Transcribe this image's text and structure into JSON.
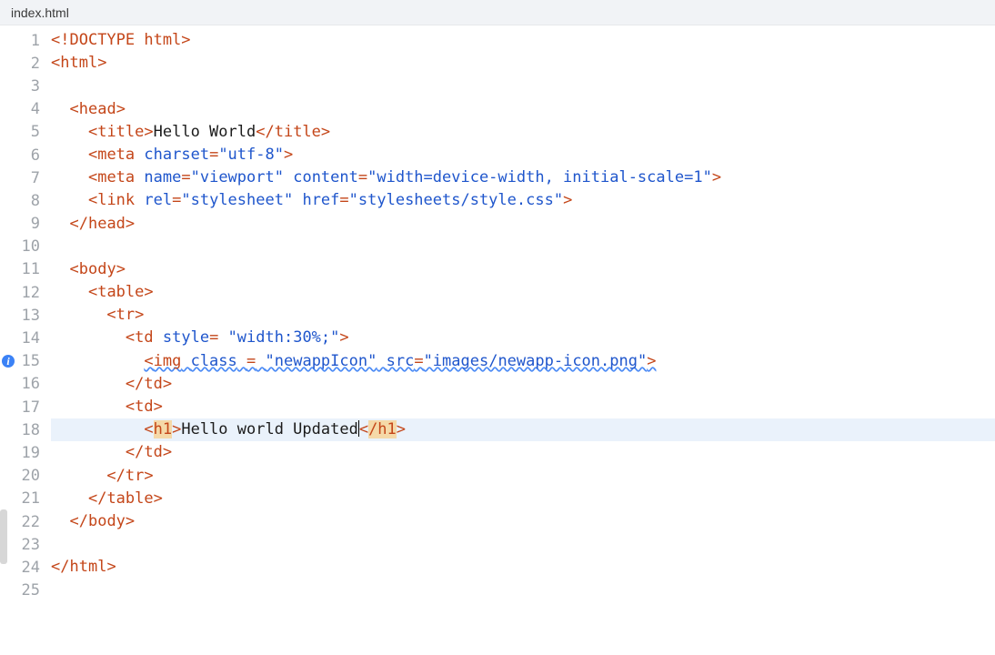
{
  "file": {
    "name": "index.html"
  },
  "editor": {
    "highlightedLine": 18,
    "infoMarkerLine": 15
  },
  "lines": {
    "1": [
      {
        "cls": "tk-doctype",
        "t": "<!DOCTYPE html>"
      }
    ],
    "2": [
      {
        "cls": "tk-punct",
        "t": "<"
      },
      {
        "cls": "tk-tag",
        "t": "html"
      },
      {
        "cls": "tk-punct",
        "t": ">"
      }
    ],
    "3": [],
    "4": [
      {
        "cls": "",
        "t": "  "
      },
      {
        "cls": "tk-punct",
        "t": "<"
      },
      {
        "cls": "tk-tag",
        "t": "head"
      },
      {
        "cls": "tk-punct",
        "t": ">"
      }
    ],
    "5": [
      {
        "cls": "",
        "t": "    "
      },
      {
        "cls": "tk-punct",
        "t": "<"
      },
      {
        "cls": "tk-tag",
        "t": "title"
      },
      {
        "cls": "tk-punct",
        "t": ">"
      },
      {
        "cls": "tk-text",
        "t": "Hello World"
      },
      {
        "cls": "tk-punct",
        "t": "</"
      },
      {
        "cls": "tk-tag",
        "t": "title"
      },
      {
        "cls": "tk-punct",
        "t": ">"
      }
    ],
    "6": [
      {
        "cls": "",
        "t": "    "
      },
      {
        "cls": "tk-punct",
        "t": "<"
      },
      {
        "cls": "tk-tag",
        "t": "meta"
      },
      {
        "cls": "",
        "t": " "
      },
      {
        "cls": "tk-attr",
        "t": "charset"
      },
      {
        "cls": "tk-punct",
        "t": "="
      },
      {
        "cls": "tk-str",
        "t": "\"utf-8\""
      },
      {
        "cls": "tk-punct",
        "t": ">"
      }
    ],
    "7": [
      {
        "cls": "",
        "t": "    "
      },
      {
        "cls": "tk-punct",
        "t": "<"
      },
      {
        "cls": "tk-tag",
        "t": "meta"
      },
      {
        "cls": "",
        "t": " "
      },
      {
        "cls": "tk-attr",
        "t": "name"
      },
      {
        "cls": "tk-punct",
        "t": "="
      },
      {
        "cls": "tk-str",
        "t": "\"viewport\""
      },
      {
        "cls": "",
        "t": " "
      },
      {
        "cls": "tk-attr",
        "t": "content"
      },
      {
        "cls": "tk-punct",
        "t": "="
      },
      {
        "cls": "tk-str",
        "t": "\"width=device-width, initial-scale=1\""
      },
      {
        "cls": "tk-punct",
        "t": ">"
      }
    ],
    "8": [
      {
        "cls": "",
        "t": "    "
      },
      {
        "cls": "tk-punct",
        "t": "<"
      },
      {
        "cls": "tk-tag",
        "t": "link"
      },
      {
        "cls": "",
        "t": " "
      },
      {
        "cls": "tk-attr",
        "t": "rel"
      },
      {
        "cls": "tk-punct",
        "t": "="
      },
      {
        "cls": "tk-str",
        "t": "\"stylesheet\""
      },
      {
        "cls": "",
        "t": " "
      },
      {
        "cls": "tk-attr",
        "t": "href"
      },
      {
        "cls": "tk-punct",
        "t": "="
      },
      {
        "cls": "tk-str",
        "t": "\"stylesheets/style.css\""
      },
      {
        "cls": "tk-punct",
        "t": ">"
      }
    ],
    "9": [
      {
        "cls": "",
        "t": "  "
      },
      {
        "cls": "tk-punct",
        "t": "</"
      },
      {
        "cls": "tk-tag",
        "t": "head"
      },
      {
        "cls": "tk-punct",
        "t": ">"
      }
    ],
    "10": [],
    "11": [
      {
        "cls": "",
        "t": "  "
      },
      {
        "cls": "tk-punct",
        "t": "<"
      },
      {
        "cls": "tk-tag",
        "t": "body"
      },
      {
        "cls": "tk-punct",
        "t": ">"
      }
    ],
    "12": [
      {
        "cls": "",
        "t": "    "
      },
      {
        "cls": "tk-punct",
        "t": "<"
      },
      {
        "cls": "tk-tag",
        "t": "table"
      },
      {
        "cls": "tk-punct",
        "t": ">"
      }
    ],
    "13": [
      {
        "cls": "",
        "t": "      "
      },
      {
        "cls": "tk-punct",
        "t": "<"
      },
      {
        "cls": "tk-tag",
        "t": "tr"
      },
      {
        "cls": "tk-punct",
        "t": ">"
      }
    ],
    "14": [
      {
        "cls": "",
        "t": "        "
      },
      {
        "cls": "tk-punct",
        "t": "<"
      },
      {
        "cls": "tk-tag",
        "t": "td"
      },
      {
        "cls": "",
        "t": " "
      },
      {
        "cls": "tk-attr",
        "t": "style"
      },
      {
        "cls": "tk-punct",
        "t": "="
      },
      {
        "cls": "",
        "t": " "
      },
      {
        "cls": "tk-str",
        "t": "\"width:30%;\""
      },
      {
        "cls": "tk-punct",
        "t": ">"
      }
    ],
    "15": [
      {
        "cls": "",
        "t": "          "
      },
      {
        "cls": "tk-punct tk-squig",
        "t": "<"
      },
      {
        "cls": "tk-tag tk-squig",
        "t": "img"
      },
      {
        "cls": "tk-squig",
        "t": " "
      },
      {
        "cls": "tk-attr tk-squig",
        "t": "class"
      },
      {
        "cls": "tk-squig",
        "t": " "
      },
      {
        "cls": "tk-punct tk-squig",
        "t": "="
      },
      {
        "cls": "tk-squig",
        "t": " "
      },
      {
        "cls": "tk-str tk-squig",
        "t": "\"newappIcon\""
      },
      {
        "cls": "tk-squig",
        "t": " "
      },
      {
        "cls": "tk-attr tk-squig",
        "t": "src"
      },
      {
        "cls": "tk-punct tk-squig",
        "t": "="
      },
      {
        "cls": "tk-str tk-squig",
        "t": "\"images/newapp-icon.png\""
      },
      {
        "cls": "tk-punct tk-squig",
        "t": ">"
      }
    ],
    "16": [
      {
        "cls": "",
        "t": "        "
      },
      {
        "cls": "tk-punct",
        "t": "</"
      },
      {
        "cls": "tk-tag",
        "t": "td"
      },
      {
        "cls": "tk-punct",
        "t": ">"
      }
    ],
    "17": [
      {
        "cls": "",
        "t": "        "
      },
      {
        "cls": "tk-punct",
        "t": "<"
      },
      {
        "cls": "tk-tag",
        "t": "td"
      },
      {
        "cls": "tk-punct",
        "t": ">"
      }
    ],
    "18": [
      {
        "cls": "",
        "t": "          "
      },
      {
        "cls": "tk-punct",
        "t": "<"
      },
      {
        "cls": "tk-tag tk-hlchange",
        "t": "h1"
      },
      {
        "cls": "tk-punct",
        "t": ">"
      },
      {
        "cls": "tk-text",
        "t": "Hello world Updated"
      },
      {
        "cls": "cursor",
        "t": ""
      },
      {
        "cls": "tk-punct",
        "t": "<"
      },
      {
        "cls": "tk-tag tk-hlchange",
        "t": "/h1"
      },
      {
        "cls": "tk-punct",
        "t": ">"
      }
    ],
    "19": [
      {
        "cls": "",
        "t": "        "
      },
      {
        "cls": "tk-punct",
        "t": "</"
      },
      {
        "cls": "tk-tag",
        "t": "td"
      },
      {
        "cls": "tk-punct",
        "t": ">"
      }
    ],
    "20": [
      {
        "cls": "",
        "t": "      "
      },
      {
        "cls": "tk-punct",
        "t": "</"
      },
      {
        "cls": "tk-tag",
        "t": "tr"
      },
      {
        "cls": "tk-punct",
        "t": ">"
      }
    ],
    "21": [
      {
        "cls": "",
        "t": "    "
      },
      {
        "cls": "tk-punct",
        "t": "</"
      },
      {
        "cls": "tk-tag",
        "t": "table"
      },
      {
        "cls": "tk-punct",
        "t": ">"
      }
    ],
    "22": [
      {
        "cls": "",
        "t": "  "
      },
      {
        "cls": "tk-punct",
        "t": "</"
      },
      {
        "cls": "tk-tag",
        "t": "body"
      },
      {
        "cls": "tk-punct",
        "t": ">"
      }
    ],
    "23": [],
    "24": [
      {
        "cls": "tk-punct",
        "t": "</"
      },
      {
        "cls": "tk-tag",
        "t": "html"
      },
      {
        "cls": "tk-punct",
        "t": ">"
      }
    ],
    "25": []
  },
  "lineCount": 25
}
